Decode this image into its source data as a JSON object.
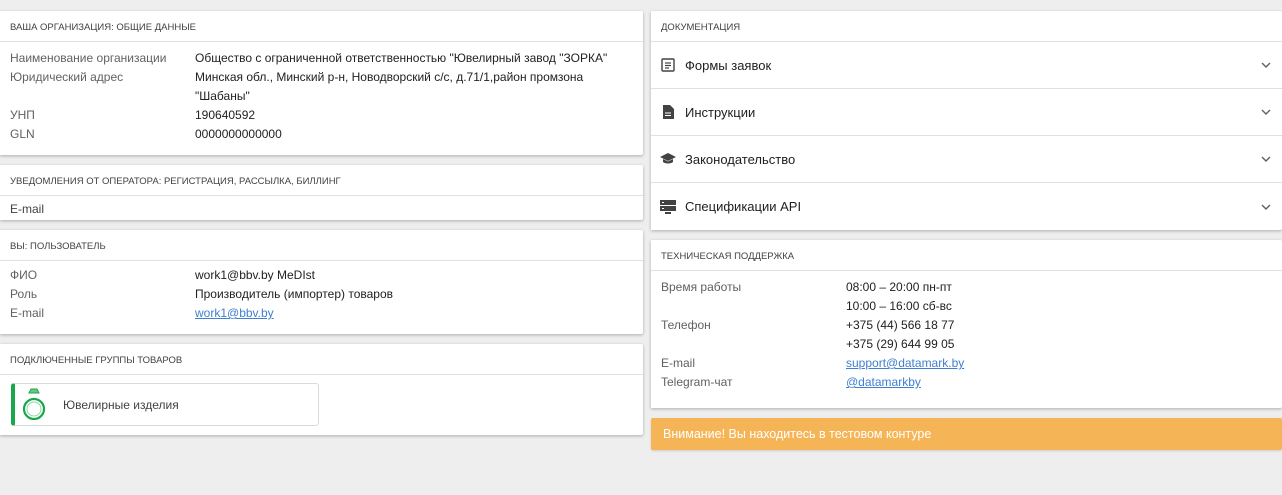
{
  "org": {
    "title": "Ваша организация: общие данные",
    "rows": [
      {
        "label": "Наименование организации",
        "value": "Общество с ограниченной ответственностью \"Ювелирный завод \"ЗОРКА\""
      },
      {
        "label": "Юридический адрес",
        "value": "Минская обл., Минский р-н, Новодворский с/с, д.71/1,район промзона \"Шабаны\""
      },
      {
        "label": "УНП",
        "value": "190640592"
      },
      {
        "label": "GLN",
        "value": "0000000000000"
      }
    ]
  },
  "notifications": {
    "title": "Уведомления от оператора: регистрация, рассылка, биллинг",
    "email_label": "E-mail"
  },
  "user": {
    "title": "Вы: пользователь",
    "rows": [
      {
        "label": "ФИО",
        "value": "work1@bbv.by MeDIst"
      },
      {
        "label": "Роль",
        "value": "Производитель (импортер) товаров"
      },
      {
        "label": "E-mail",
        "value": "work1@bbv.by"
      }
    ]
  },
  "groups": {
    "title": "Подключенные группы товаров",
    "items": [
      {
        "label": "Ювелирные изделия",
        "icon": "ring-icon",
        "accent": "#18a84a"
      }
    ]
  },
  "docs": {
    "title": "Документация",
    "items": [
      {
        "label": "Формы заявок",
        "icon": "form-icon"
      },
      {
        "label": "Инструкции",
        "icon": "document-icon"
      },
      {
        "label": "Законодательство",
        "icon": "graduation-cap-icon"
      },
      {
        "label": "Спецификации API",
        "icon": "server-icon"
      }
    ]
  },
  "support": {
    "title": "Техническая поддержка",
    "hours_label": "Время работы",
    "hours": [
      "08:00 – 20:00 пн-пт",
      "10:00 – 16:00 сб-вс"
    ],
    "phone_label": "Телефон",
    "phones": [
      "+375 (44) 566 18 77",
      "+375 (29) 644 99 05"
    ],
    "email_label": "E-mail",
    "email": "support@datamark.by",
    "telegram_label": "Telegram-чат",
    "telegram": "@datamarkby"
  },
  "banner": {
    "text": "Внимание! Вы находитесь в тестовом контуре",
    "color": "#f5b556"
  }
}
